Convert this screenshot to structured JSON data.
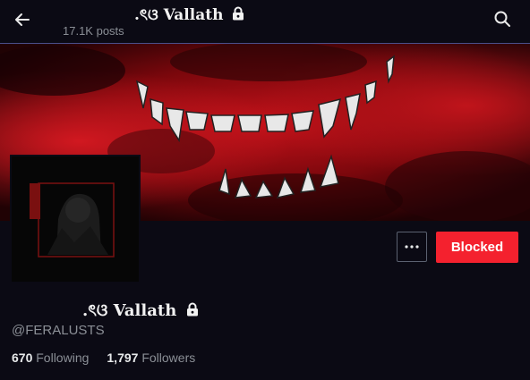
{
  "header": {
    "name_decoration": ".ৎଓ",
    "name": "Vallath",
    "posts": "17.1K posts"
  },
  "profile": {
    "name_decoration": ".ৎଓ",
    "name": "Vallath",
    "handle": "@FERALUSTS",
    "following_count": "670",
    "following_label": "Following",
    "followers_count": "1,797",
    "followers_label": "Followers",
    "protected": true
  },
  "actions": {
    "more_icon": "ellipsis-icon",
    "blocked_label": "Blocked"
  },
  "icons": {
    "back": "arrow-left-icon",
    "search": "search-icon",
    "lock": "lock-icon"
  },
  "colors": {
    "background": "#0b0a14",
    "blocked_button": "#f4212e",
    "banner_red": "#b00a12",
    "secondary_text": "#8b8f96"
  }
}
